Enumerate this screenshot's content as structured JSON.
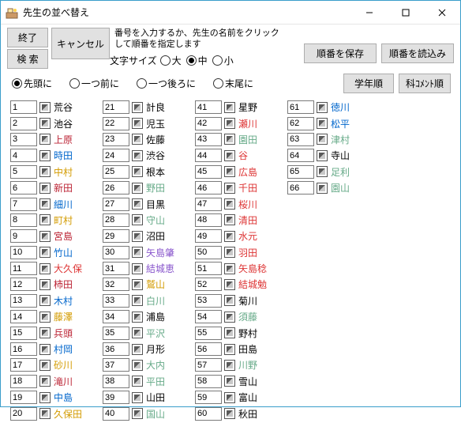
{
  "window": {
    "title": "先生の並べ替え"
  },
  "toolbar": {
    "exit": "終了",
    "search": "検 索",
    "cancel": "キャンセル",
    "hint": "番号を入力するか、先生の名前をクリックして順番を指定します",
    "font_label": "文字サイズ",
    "font_large": "大",
    "font_medium": "中",
    "font_small": "小",
    "save_order": "順番を保存",
    "load_order": "順番を読込み"
  },
  "position": {
    "head": "先頭に",
    "prev": "一つ前に",
    "next": "一つ後ろに",
    "tail": "末尾に",
    "grade_order": "学年順",
    "comment_order": "科ｺﾒﾝﾄ順"
  },
  "teachers": [
    {
      "n": "1",
      "name": "荒谷",
      "c": "#000"
    },
    {
      "n": "2",
      "name": "池谷",
      "c": "#000"
    },
    {
      "n": "3",
      "name": "上原",
      "c": "#b23"
    },
    {
      "n": "4",
      "name": "時田",
      "c": "#06c"
    },
    {
      "n": "5",
      "name": "中村",
      "c": "#d39b00"
    },
    {
      "n": "6",
      "name": "新田",
      "c": "#b23"
    },
    {
      "n": "7",
      "name": "細川",
      "c": "#06c"
    },
    {
      "n": "8",
      "name": "町村",
      "c": "#d39b00"
    },
    {
      "n": "9",
      "name": "宮島",
      "c": "#b23"
    },
    {
      "n": "10",
      "name": "竹山",
      "c": "#06c"
    },
    {
      "n": "11",
      "name": "大久保",
      "c": "#d33"
    },
    {
      "n": "12",
      "name": "柿田",
      "c": "#b23"
    },
    {
      "n": "13",
      "name": "木村",
      "c": "#06c"
    },
    {
      "n": "14",
      "name": "藤澤",
      "c": "#d39b00"
    },
    {
      "n": "15",
      "name": "兵頭",
      "c": "#b23"
    },
    {
      "n": "16",
      "name": "村岡",
      "c": "#06c"
    },
    {
      "n": "17",
      "name": "砂川",
      "c": "#d39b00"
    },
    {
      "n": "18",
      "name": "滝川",
      "c": "#b23"
    },
    {
      "n": "19",
      "name": "中島",
      "c": "#06c"
    },
    {
      "n": "20",
      "name": "久保田",
      "c": "#d39b00"
    },
    {
      "n": "21",
      "name": "計良",
      "c": "#000"
    },
    {
      "n": "22",
      "name": "児玉",
      "c": "#000"
    },
    {
      "n": "23",
      "name": "佐藤",
      "c": "#000"
    },
    {
      "n": "24",
      "name": "渋谷",
      "c": "#000"
    },
    {
      "n": "25",
      "name": "根本",
      "c": "#000"
    },
    {
      "n": "26",
      "name": "野田",
      "c": "#6a8"
    },
    {
      "n": "27",
      "name": "目黒",
      "c": "#000"
    },
    {
      "n": "28",
      "name": "守山",
      "c": "#6a8"
    },
    {
      "n": "29",
      "name": "沼田",
      "c": "#000"
    },
    {
      "n": "30",
      "name": "矢島肇",
      "c": "#85c"
    },
    {
      "n": "31",
      "name": "結城恵",
      "c": "#85c"
    },
    {
      "n": "32",
      "name": "鷲山",
      "c": "#d39b00"
    },
    {
      "n": "33",
      "name": "白川",
      "c": "#6a8"
    },
    {
      "n": "34",
      "name": "浦島",
      "c": "#000"
    },
    {
      "n": "35",
      "name": "平沢",
      "c": "#6a8"
    },
    {
      "n": "36",
      "name": "月形",
      "c": "#000"
    },
    {
      "n": "37",
      "name": "大内",
      "c": "#6a8"
    },
    {
      "n": "38",
      "name": "平田",
      "c": "#6a8"
    },
    {
      "n": "39",
      "name": "山田",
      "c": "#000"
    },
    {
      "n": "40",
      "name": "国山",
      "c": "#6a8"
    },
    {
      "n": "41",
      "name": "星野",
      "c": "#000"
    },
    {
      "n": "42",
      "name": "瀬川",
      "c": "#d33"
    },
    {
      "n": "43",
      "name": "園田",
      "c": "#6a8"
    },
    {
      "n": "44",
      "name": "谷",
      "c": "#d33"
    },
    {
      "n": "45",
      "name": "広島",
      "c": "#d33"
    },
    {
      "n": "46",
      "name": "千田",
      "c": "#d33"
    },
    {
      "n": "47",
      "name": "桜川",
      "c": "#d33"
    },
    {
      "n": "48",
      "name": "清田",
      "c": "#d33"
    },
    {
      "n": "49",
      "name": "水元",
      "c": "#d33"
    },
    {
      "n": "50",
      "name": "羽田",
      "c": "#d33"
    },
    {
      "n": "51",
      "name": "矢島稔",
      "c": "#d33"
    },
    {
      "n": "52",
      "name": "結城勉",
      "c": "#d33"
    },
    {
      "n": "53",
      "name": "菊川",
      "c": "#000"
    },
    {
      "n": "54",
      "name": "須藤",
      "c": "#6a8"
    },
    {
      "n": "55",
      "name": "野村",
      "c": "#000"
    },
    {
      "n": "56",
      "name": "田島",
      "c": "#000"
    },
    {
      "n": "57",
      "name": "川野",
      "c": "#6a8"
    },
    {
      "n": "58",
      "name": "雪山",
      "c": "#000"
    },
    {
      "n": "59",
      "name": "富山",
      "c": "#000"
    },
    {
      "n": "60",
      "name": "秋田",
      "c": "#000"
    },
    {
      "n": "61",
      "name": "徳川",
      "c": "#06c"
    },
    {
      "n": "62",
      "name": "松平",
      "c": "#06c"
    },
    {
      "n": "63",
      "name": "津村",
      "c": "#6a8"
    },
    {
      "n": "64",
      "name": "寺山",
      "c": "#000"
    },
    {
      "n": "65",
      "name": "足利",
      "c": "#6a8"
    },
    {
      "n": "66",
      "name": "園山",
      "c": "#6a8"
    }
  ]
}
